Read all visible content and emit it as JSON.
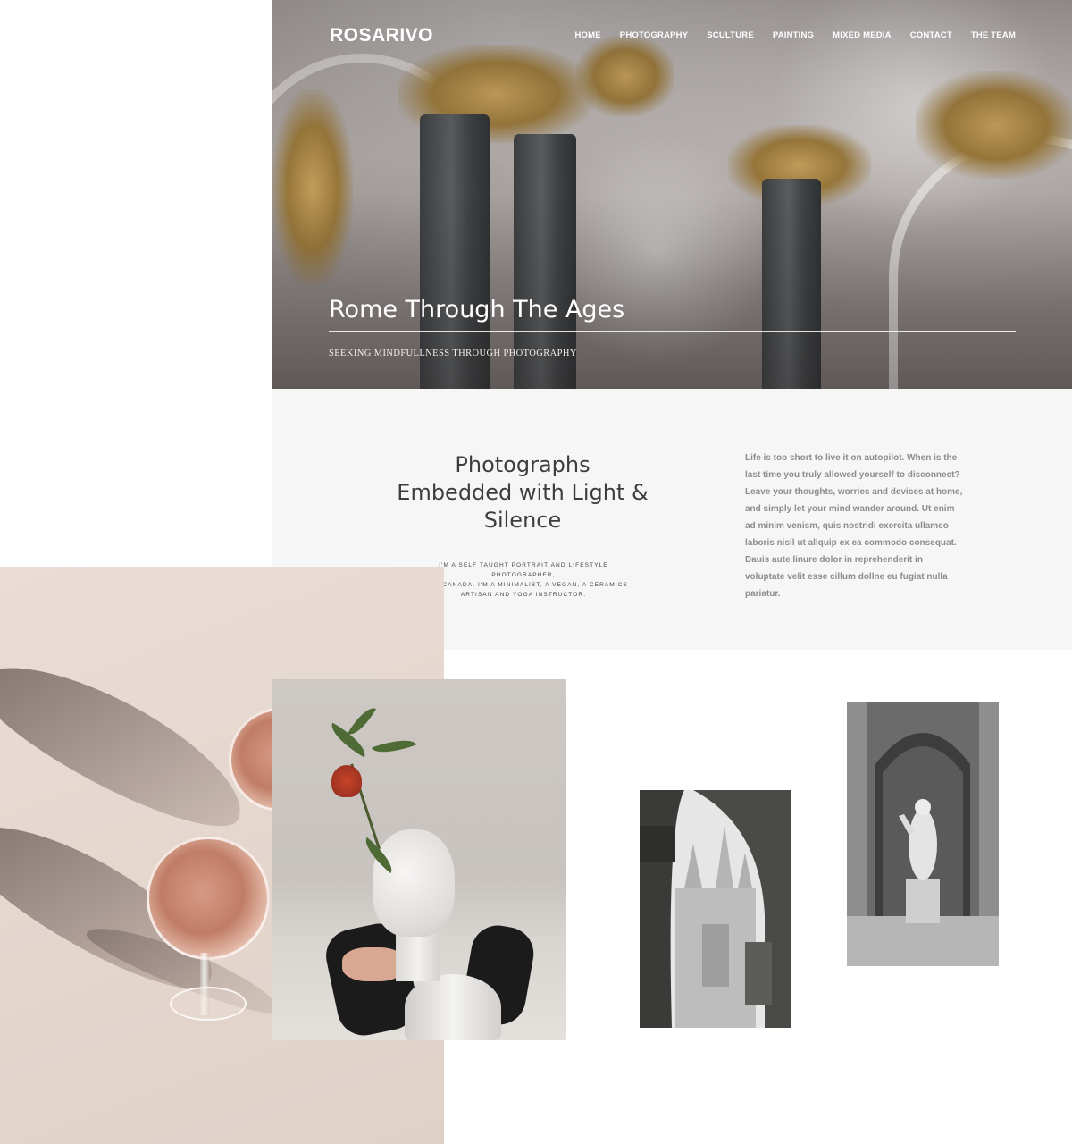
{
  "site": {
    "brand": "ROSARIVO",
    "nav": [
      "HOME",
      "PHOTOGRAPHY",
      "SCULTURE",
      "PAINTING",
      "MIXED MEDIA",
      "CONTACT",
      "THE TEAM"
    ]
  },
  "hero": {
    "title": "Rome Through The Ages",
    "subtitle": "SEEKING MINDFULLNESS THROUGH PHOTOGRAPHY"
  },
  "intro": {
    "heading_line1": "Photographs",
    "heading_line2": "Embedded with Light &",
    "heading_line3": "Silence",
    "small_line1": "I'M A SELF TAUGHT PORTRAIT AND LIFESTYLE PHOTOGRAPHER,",
    "small_line2": "FROM CANADA. I'M A MINIMALIST, A VEGAN, A CERAMICS",
    "small_line3": "ARTISAN AND YOGA INSTRUCTOR.",
    "paragraph": "Life is too short to live it on autopilot. When is the last time you truly allowed yourself to disconnect? Leave your thoughts, worries and devices at home, and simply let your mind wander around. Ut enim ad minim venism, quis nostridi exercita ullamco laboris nisil ut allquip ex ea commodo consequat. Dauis aute linure dolor in reprehenderit in voluptate velit esse cillum dollne eu fugiat nulla pariatur."
  },
  "gallery": {
    "images": [
      "rose-wine-glasses-photo",
      "bust-with-flower-photo",
      "cathedral-through-arch-photo",
      "statue-in-niche-photo"
    ]
  }
}
